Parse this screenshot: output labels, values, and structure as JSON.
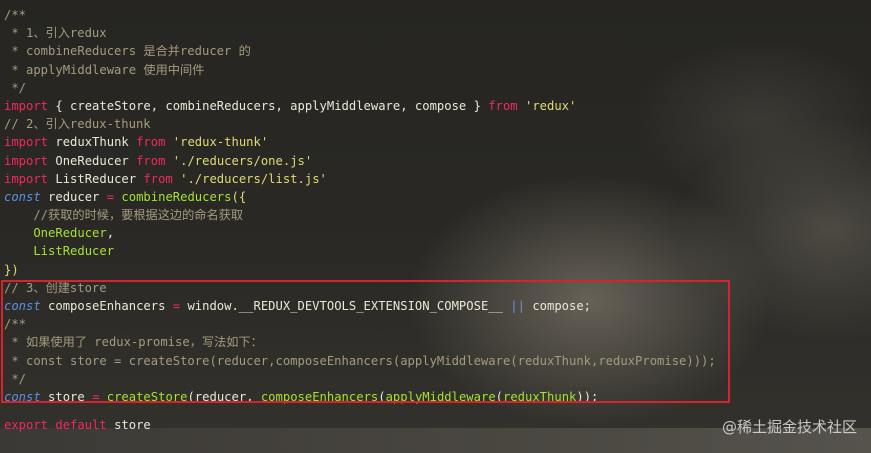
{
  "lines": [
    [
      {
        "t": "c",
        "v": "/**"
      }
    ],
    [
      {
        "t": "c",
        "v": " * 1、引入redux"
      }
    ],
    [
      {
        "t": "c",
        "v": " * combineReducers 是合并reducer 的"
      }
    ],
    [
      {
        "t": "c",
        "v": " * applyMiddleware 使用中间件"
      }
    ],
    [
      {
        "t": "c",
        "v": " */"
      }
    ],
    [
      {
        "t": "k",
        "v": "import"
      },
      {
        "t": "p",
        "v": " { "
      },
      {
        "t": "w",
        "v": "createStore, combineReducers, applyMiddleware, compose"
      },
      {
        "t": "p",
        "v": " } "
      },
      {
        "t": "k",
        "v": "from"
      },
      {
        "t": "p",
        "v": " "
      },
      {
        "t": "s",
        "v": "'redux'"
      }
    ],
    [
      {
        "t": "c",
        "v": "// 2、引入redux-thunk"
      }
    ],
    [
      {
        "t": "k",
        "v": "import"
      },
      {
        "t": "w",
        "v": " reduxThunk "
      },
      {
        "t": "k",
        "v": "from"
      },
      {
        "t": "p",
        "v": " "
      },
      {
        "t": "s",
        "v": "'redux-thunk'"
      }
    ],
    [
      {
        "t": "k",
        "v": "import"
      },
      {
        "t": "w",
        "v": " OneReducer "
      },
      {
        "t": "k",
        "v": "from"
      },
      {
        "t": "p",
        "v": " "
      },
      {
        "t": "s",
        "v": "'./reducers/one.js'"
      }
    ],
    [
      {
        "t": "k",
        "v": "import"
      },
      {
        "t": "w",
        "v": " ListReducer "
      },
      {
        "t": "k",
        "v": "from"
      },
      {
        "t": "p",
        "v": " "
      },
      {
        "t": "s",
        "v": "'./reducers/list.js'"
      }
    ],
    [
      {
        "t": "sk",
        "v": "const"
      },
      {
        "t": "w",
        "v": " reducer "
      },
      {
        "t": "k",
        "v": "="
      },
      {
        "t": "p",
        "v": " "
      },
      {
        "t": "f",
        "v": "combineReducers"
      },
      {
        "t": "s",
        "v": "({"
      }
    ],
    [
      {
        "t": "c",
        "v": "    //获取的时候，要根据这边的命名获取"
      }
    ],
    [
      {
        "t": "f",
        "v": "    OneReducer"
      },
      {
        "t": "w",
        "v": ","
      }
    ],
    [
      {
        "t": "f",
        "v": "    ListReducer"
      }
    ],
    [
      {
        "t": "s",
        "v": "})"
      }
    ],
    [
      {
        "t": "c",
        "v": "// 3、创建store"
      }
    ],
    [
      {
        "t": "sk",
        "v": "const"
      },
      {
        "t": "w",
        "v": " composeEnhancers "
      },
      {
        "t": "k",
        "v": "="
      },
      {
        "t": "w",
        "v": " window.__REDUX_DEVTOOLS_EXTENSION_COMPOSE__ "
      },
      {
        "t": "or",
        "v": "||"
      },
      {
        "t": "w",
        "v": " compose;"
      }
    ],
    [
      {
        "t": "c",
        "v": "/**"
      }
    ],
    [
      {
        "t": "c",
        "v": " * 如果使用了 redux-promise，写法如下："
      }
    ],
    [
      {
        "t": "c",
        "v": " * const store = createStore(reducer,composeEnhancers(applyMiddleware(reduxThunk,reduxPromise)));"
      }
    ],
    [
      {
        "t": "c",
        "v": " */"
      }
    ],
    [
      {
        "t": "sk",
        "v": "const"
      },
      {
        "t": "w",
        "v": " store "
      },
      {
        "t": "k",
        "v": "="
      },
      {
        "t": "p",
        "v": " "
      },
      {
        "t": "f",
        "v": "createStore"
      },
      {
        "t": "w",
        "v": "(reducer, "
      },
      {
        "t": "f",
        "v": "composeEnhancers"
      },
      {
        "t": "w",
        "v": "("
      },
      {
        "t": "f",
        "v": "applyMiddleware"
      },
      {
        "t": "w",
        "v": "("
      },
      {
        "t": "f",
        "v": "reduxThunk"
      },
      {
        "t": "w",
        "v": "));"
      }
    ],
    [],
    [
      {
        "t": "k",
        "v": "export"
      },
      {
        "t": "p",
        "v": " "
      },
      {
        "t": "k",
        "v": "default"
      },
      {
        "t": "w",
        "v": " store"
      }
    ]
  ],
  "watermark": "@稀土掘金技术社区",
  "colors": {
    "comment": "#a59b7e",
    "keyword": "#f02a5c",
    "storage": "#5890e6",
    "string": "#e0db74",
    "function": "#a6e22e",
    "text": "#ece8d8",
    "highlight_border": "#d6242e"
  }
}
